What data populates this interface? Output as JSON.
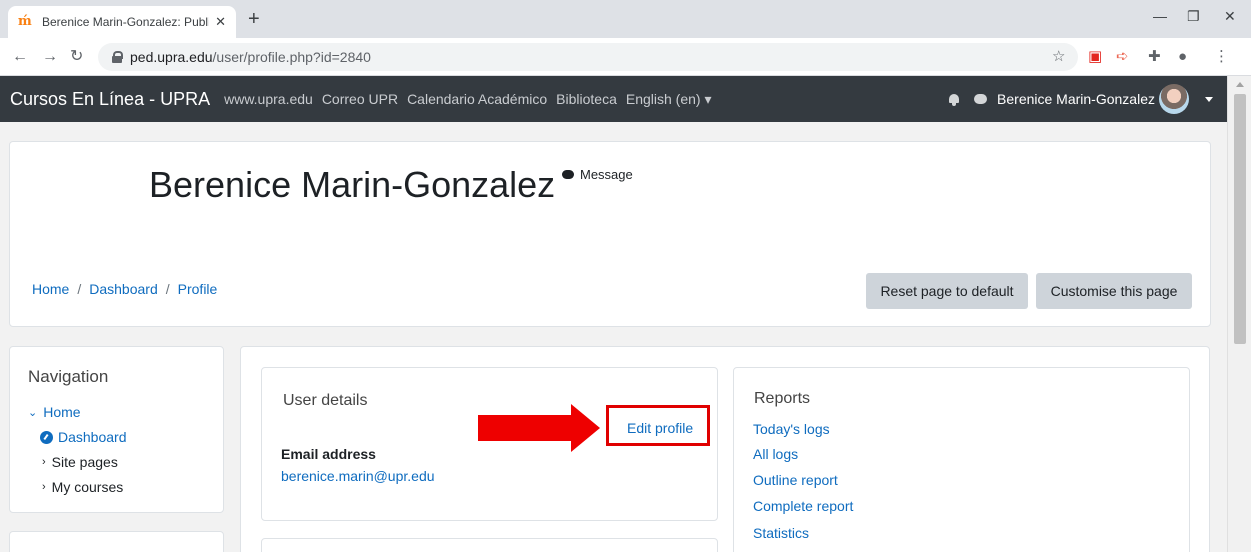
{
  "browser": {
    "tab_title": "Berenice Marin-Gonzalez: Public",
    "tab_favicon": "ḿ",
    "tab_close": "✕",
    "new_tab": "+",
    "url_host": "ped.upra.edu",
    "url_path": "/user/profile.php?id=2840"
  },
  "navbar": {
    "brand": "Cursos En Línea - UPRA",
    "links": [
      "www.upra.edu",
      "Correo UPR",
      "Calendario Académico",
      "Biblioteca",
      "English (en) ▾"
    ],
    "user_name": "Berenice Marin-Gonzalez"
  },
  "header": {
    "title": "Berenice Marin-Gonzalez",
    "message_label": "Message",
    "breadcrumb": [
      "Home",
      "Dashboard",
      "Profile"
    ],
    "reset_button": "Reset page to default",
    "customise_button": "Customise this page"
  },
  "navigation": {
    "title": "Navigation",
    "home": "Home",
    "dashboard": "Dashboard",
    "site_pages": "Site pages",
    "my_courses": "My courses"
  },
  "user_details": {
    "title": "User details",
    "edit_profile": "Edit profile",
    "email_label": "Email address",
    "email_value": "berenice.marin@upr.edu"
  },
  "reports": {
    "title": "Reports",
    "links": [
      "Today's logs",
      "All logs",
      "Outline report",
      "Complete report",
      "Statistics"
    ]
  },
  "colors": {
    "accent": "#0f6cbf",
    "navbar": "#343a40",
    "annotation": "#ee0000"
  }
}
